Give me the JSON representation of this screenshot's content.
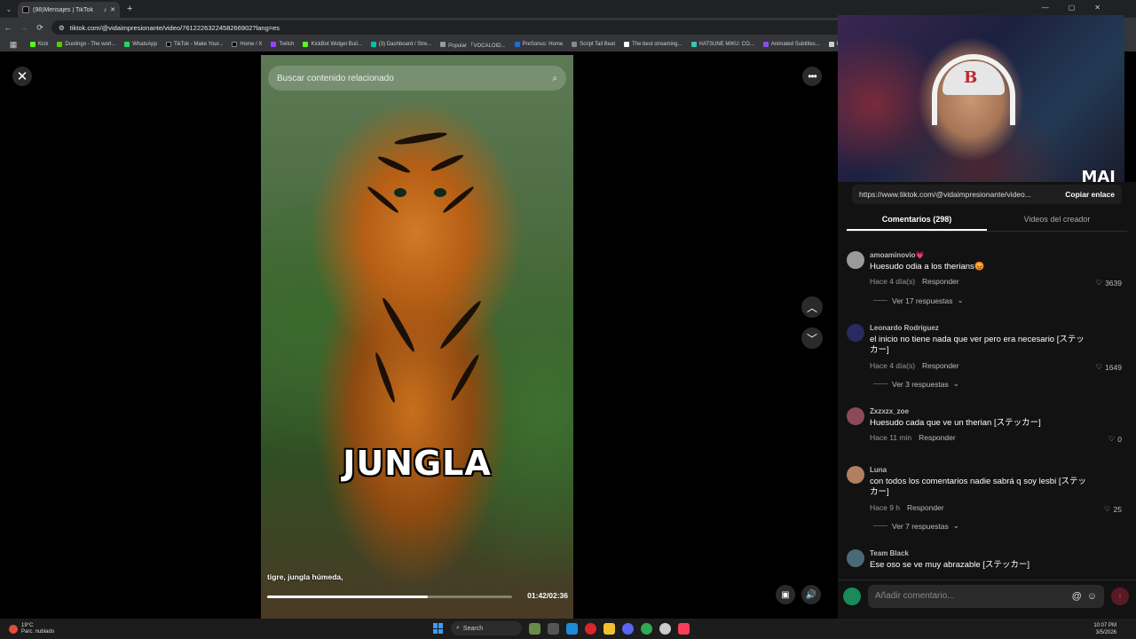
{
  "browser": {
    "tab_title": "(98)Mensajes | TikTok",
    "new_tab": "+",
    "url": "tiktok.com/@vidaimpresionante/video/7612226322458266902?lang=es",
    "bookmarks": [
      "Kick",
      "Duolingo - The worl...",
      "WhatsApp",
      "TikTok - Make Your...",
      "Home / X",
      "Twitch",
      "KickBot Widget Buil...",
      "(3) Dashboard / Stre...",
      "Popular 「VOCALOID...",
      "PreSonus: Home",
      "Script Tail Beat",
      "The best streaming...",
      "HATSUNE MIKU: CO...",
      "Animated Subtitles...",
      "HA"
    ]
  },
  "video": {
    "search_placeholder": "Buscar contenido relacionado",
    "overlay_text": "JUNGLA",
    "subtitle": "tigre, jungla húmeda,",
    "time": "01:42/02:36",
    "progress": 0.654
  },
  "webcam": {
    "overlay": "MAI"
  },
  "panel": {
    "share_url": "https://www.tiktok.com/@vidaimpresionante/video...",
    "copy_label": "Copiar enlace",
    "tab_comments": "Comentarios (298)",
    "tab_creator": "Videos del creador",
    "comments": [
      {
        "user": "amoaminovio💗",
        "text": "Huesudo odia a los therians😡",
        "time": "Hace 4 día(s)",
        "reply": "Responder",
        "likes": "3639",
        "more": "Ver 17 respuestas",
        "color": "#9a9a9a"
      },
      {
        "user": "Leonardo Rodríguez",
        "text": "el inicio no tiene nada que ver pero era necesario [ステッカー]",
        "time": "Hace 4 día(s)",
        "reply": "Responder",
        "likes": "1649",
        "more": "Ver 3 respuestas",
        "color": "#2a2a60"
      },
      {
        "user": "Zxzxzx_zoe",
        "text": "Huesudo cada que ve un therian [ステッカー]",
        "time": "Hace 11 min",
        "reply": "Responder",
        "likes": "0",
        "more": "",
        "color": "#8a4a5a"
      },
      {
        "user": "Luna",
        "text": "con todos los comentarios nadie sabrá q soy lesbi [ステッカー]",
        "time": "Hace 9 h",
        "reply": "Responder",
        "likes": "25",
        "more": "Ver 7 respuestas",
        "color": "#b08060"
      },
      {
        "user": "Team Black",
        "text": "Ese oso se ve muy abrazable [ステッカー]",
        "time": "",
        "reply": "",
        "likes": "",
        "more": "",
        "color": "#4a6a7a"
      }
    ],
    "add_comment_placeholder": "Añadir comentario..."
  },
  "taskbar": {
    "temp": "19°C",
    "weather": "Parc. nublado",
    "search": "Search",
    "time": "10:07 PM",
    "date": "3/5/2026"
  }
}
